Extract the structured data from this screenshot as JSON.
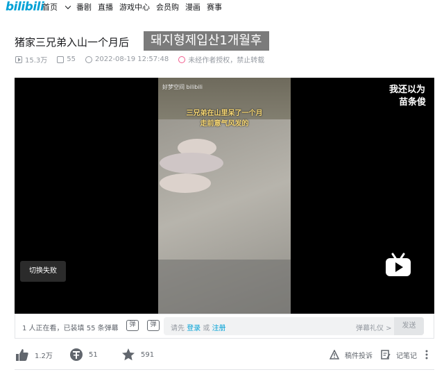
{
  "nav": {
    "logo": "bilibili",
    "items": [
      "首页",
      "番剧",
      "直播",
      "游戏中心",
      "会员购",
      "漫画",
      "赛事"
    ]
  },
  "video": {
    "title": "猪家三兄弟入山一个月后",
    "overlay_title": "돼지형제입산1개월후",
    "views": "15.3万",
    "danmaku_count": "55",
    "datetime": "2022-08-19 12:57:48",
    "copyright": "未经作者授权，禁止转载"
  },
  "player": {
    "watermark": "好梦空间 bilibili",
    "subtitle_line1": "三兄弟在山里呆了一个月",
    "subtitle_line2": "走前意气风发的",
    "danmaku_line1": "我还以为",
    "danmaku_line2": "苗条俊",
    "switch_fail": "切换失败"
  },
  "controls": {
    "watching": "1 人正在看，已装填 55 条弹幕",
    "input_prefix": "请先",
    "login": "登录",
    "or": "或",
    "register": "注册",
    "etiquette": "弹幕礼仪 >",
    "send": "发送"
  },
  "actions": {
    "likes": "1.2万",
    "coins": "51",
    "favorites": "591",
    "report": "稿件投诉",
    "notes": "记笔记"
  },
  "colors": {
    "brand": "#00a1d6",
    "warning": "#f25d8e"
  }
}
